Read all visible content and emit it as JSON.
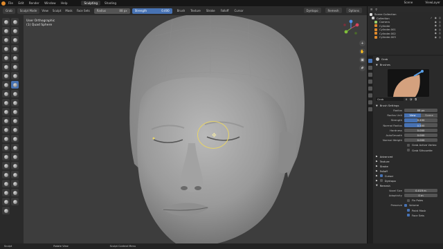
{
  "topbar": {
    "menus": [
      "File",
      "Edit",
      "Render",
      "Window",
      "Help"
    ],
    "workspaces": [
      "Sculpting",
      "Shading"
    ],
    "active_workspace": "Sculpting",
    "scene": "Scene",
    "view_layer": "ViewLayer"
  },
  "header": {
    "brush_name": "Grab",
    "mode": "Sculpt Mode",
    "menus": [
      "View",
      "Sculpt",
      "Mask",
      "Face Sets"
    ],
    "radius_label": "Radius",
    "radius_value": "88 px",
    "strength_label": "Strength",
    "strength_value": "0.400",
    "dropdowns": [
      "Brush",
      "Texture",
      "Stroke",
      "Falloff",
      "Cursor"
    ],
    "dyntopo": "Dyntopo",
    "remesh": "Remesh",
    "options": "Options"
  },
  "viewport": {
    "view_name": "User Orthographic",
    "object_name": "(1) Quad Sphere"
  },
  "outliner": {
    "header": "Scene Collection",
    "items": [
      {
        "name": "Collection",
        "color": "#cccccc"
      },
      {
        "name": "Camera",
        "color": "#9acd6a"
      },
      {
        "name": "Cylinder",
        "color": "#e08a2c"
      },
      {
        "name": "Cylinder.001",
        "color": "#e08a2c"
      },
      {
        "name": "Cylinder.002",
        "color": "#e08a2c"
      },
      {
        "name": "Cylinder.003",
        "color": "#e08a2c"
      }
    ]
  },
  "properties": {
    "tool_name": "Grab",
    "brushes_label": "Brushes",
    "brush_name": "Grab",
    "brush_users": "8",
    "brush_settings_label": "Brush Settings",
    "rows": {
      "radius": {
        "label": "Radius",
        "value": "88 px"
      },
      "radius_unit": {
        "label": "Radius Unit",
        "view": "View",
        "scene": "Scene"
      },
      "strength": {
        "label": "Strength",
        "value": "0.400",
        "fraction": 0.4
      },
      "normal_radius": {
        "label": "Normal Radius",
        "value": "0.500",
        "fraction": 0.5
      },
      "hardness": {
        "label": "Hardness",
        "value": "0.000"
      },
      "autosmooth": {
        "label": "AutoSmooth",
        "value": "0.000"
      },
      "normal_weight": {
        "label": "Normal Weight",
        "value": "0.000"
      }
    },
    "checks": {
      "grab_active": "Grab Active Vertex",
      "grab_silhouette": "Grab Silhouette"
    },
    "sections": [
      "Advanced",
      "Texture",
      "Stroke",
      "Falloff",
      "Cursor",
      "Dyntopo",
      "Remesh"
    ],
    "remesh": {
      "voxel_size_label": "Voxel Size",
      "voxel_size_value": "0.019 m",
      "adaptivity_label": "Adaptivity",
      "adaptivity_value": "0 m",
      "fix_poles": "Fix Poles",
      "preserve_label": "Preserve",
      "volume": "Volume",
      "paint_mask": "Paint Mask",
      "face_sets": "Face Sets"
    }
  },
  "statusbar": {
    "left": "Sculpt",
    "middle": "Rotate View",
    "right": "Sculpt Context Menu"
  }
}
